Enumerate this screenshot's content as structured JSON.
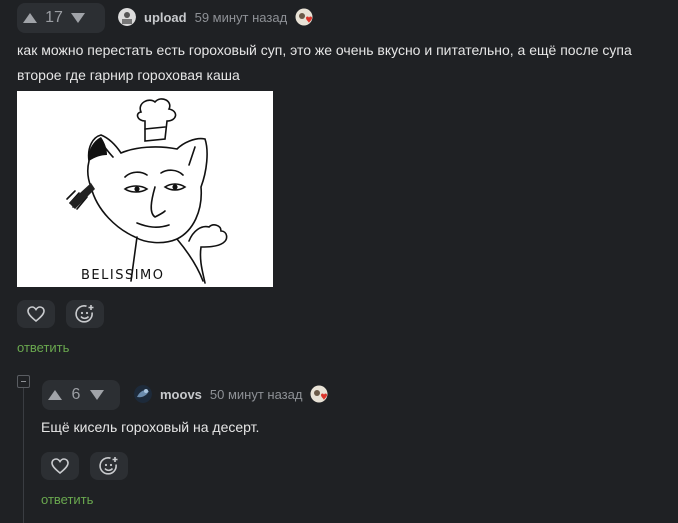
{
  "comment": {
    "rating": "17",
    "username": "upload",
    "time": "59 минут назад",
    "text_line1": "как можно перестать есть гороховый суп, это же очень вкусно и питательно, а ещё после супа",
    "text_line2": "второе где гарнир гороховая каша",
    "image_caption": "BELISSIMO",
    "reply_label": "ответить"
  },
  "reply_comment": {
    "rating": "6",
    "username": "moovs",
    "time": "50 минут назад",
    "text": "Ещё кисель гороховый на десерт.",
    "reply_label": "ответить"
  },
  "colors": {
    "background": "#1f2124",
    "panel": "#2c2f33",
    "reply_link": "#6aa84f",
    "time_text": "#8e9196"
  }
}
